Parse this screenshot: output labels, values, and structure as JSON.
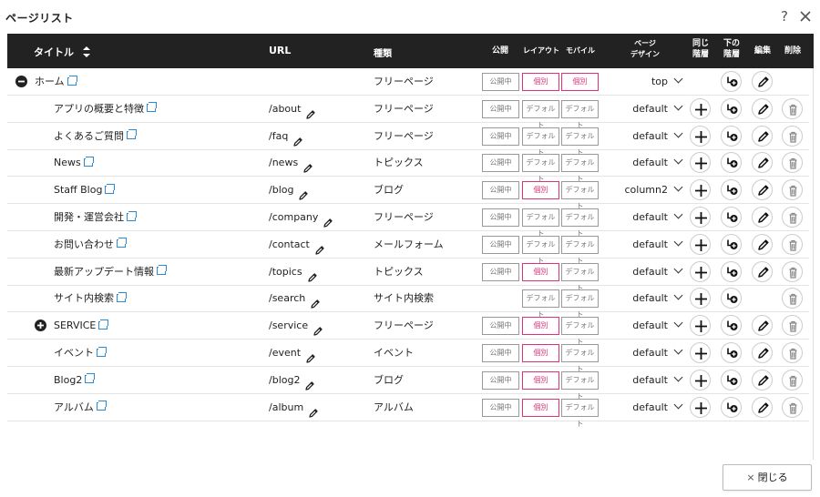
{
  "dialog": {
    "title": "ページリスト",
    "help": "?",
    "close_button": "閉じる",
    "close_glyph": "×"
  },
  "header": {
    "title": "タイトル",
    "url": "URL",
    "type": "種類",
    "publish": "公開",
    "layout": "レイアウト",
    "mobile": "モバイル",
    "page_design_line1": "ページ",
    "page_design_line2": "デザイン",
    "same_level_line1": "同じ",
    "same_level_line2": "階層",
    "lower_level_line1": "下の",
    "lower_level_line2": "階層",
    "edit": "編集",
    "delete": "削除"
  },
  "colors": {
    "header_bg": "#222222",
    "accent_pink": "#e0307a",
    "link_blue": "#2a8ad8"
  },
  "rows": [
    {
      "title": "ホーム",
      "indent": 0,
      "toggle": "minus",
      "url": "",
      "type": "フリーページ",
      "publish": "公開中",
      "layout": "個別",
      "layout_style": "pink",
      "mobile": "個別",
      "mobile_style": "pink",
      "design": "top",
      "add_same": false,
      "add_child": true,
      "edit": true,
      "delete": false
    },
    {
      "title": "アプリの概要と特徴",
      "indent": 1,
      "toggle": "",
      "url": "/about",
      "type": "フリーページ",
      "publish": "公開中",
      "layout": "デフォルト",
      "layout_style": "gray",
      "mobile": "デフォルト",
      "mobile_style": "gray",
      "design": "default",
      "add_same": true,
      "add_child": true,
      "edit": true,
      "delete": true
    },
    {
      "title": "よくあるご質問",
      "indent": 1,
      "toggle": "",
      "url": "/faq",
      "type": "フリーページ",
      "publish": "公開中",
      "layout": "デフォルト",
      "layout_style": "gray",
      "mobile": "デフォルト",
      "mobile_style": "gray",
      "design": "default",
      "add_same": true,
      "add_child": true,
      "edit": true,
      "delete": true
    },
    {
      "title": "News",
      "indent": 1,
      "toggle": "",
      "url": "/news",
      "type": "トピックス",
      "publish": "公開中",
      "layout": "デフォルト",
      "layout_style": "gray",
      "mobile": "デフォルト",
      "mobile_style": "gray",
      "design": "default",
      "add_same": true,
      "add_child": true,
      "edit": true,
      "delete": true
    },
    {
      "title": "Staff Blog",
      "indent": 1,
      "toggle": "",
      "url": "/blog",
      "type": "ブログ",
      "publish": "公開中",
      "layout": "個別",
      "layout_style": "pink",
      "mobile": "デフォルト",
      "mobile_style": "gray",
      "design": "column2",
      "add_same": true,
      "add_child": true,
      "edit": true,
      "delete": true
    },
    {
      "title": "開発・運営会社",
      "indent": 1,
      "toggle": "",
      "url": "/company",
      "type": "フリーページ",
      "publish": "公開中",
      "layout": "デフォルト",
      "layout_style": "gray",
      "mobile": "デフォルト",
      "mobile_style": "gray",
      "design": "default",
      "add_same": true,
      "add_child": true,
      "edit": true,
      "delete": true
    },
    {
      "title": "お問い合わせ",
      "indent": 1,
      "toggle": "",
      "url": "/contact",
      "type": "メールフォーム",
      "publish": "公開中",
      "layout": "デフォルト",
      "layout_style": "gray",
      "mobile": "デフォルト",
      "mobile_style": "gray",
      "design": "default",
      "add_same": true,
      "add_child": true,
      "edit": true,
      "delete": true
    },
    {
      "title": "最新アップデート情報",
      "indent": 1,
      "toggle": "",
      "url": "/topics",
      "type": "トピックス",
      "publish": "公開中",
      "layout": "個別",
      "layout_style": "pink",
      "mobile": "デフォルト",
      "mobile_style": "gray",
      "design": "default",
      "add_same": true,
      "add_child": true,
      "edit": true,
      "delete": true
    },
    {
      "title": "サイト内検索",
      "indent": 1,
      "toggle": "",
      "url": "/search",
      "type": "サイト内検索",
      "publish": "",
      "layout": "デフォルト",
      "layout_style": "gray",
      "mobile": "デフォルト",
      "mobile_style": "gray",
      "design": "default",
      "add_same": true,
      "add_child": true,
      "edit": false,
      "delete": true
    },
    {
      "title": "SERVICE",
      "indent": 1,
      "toggle": "plus",
      "url": "/service",
      "type": "フリーページ",
      "publish": "公開中",
      "layout": "個別",
      "layout_style": "pink",
      "mobile": "デフォルト",
      "mobile_style": "gray",
      "design": "default",
      "add_same": true,
      "add_child": true,
      "edit": true,
      "delete": true
    },
    {
      "title": "イベント",
      "indent": 1,
      "toggle": "",
      "url": "/event",
      "type": "イベント",
      "publish": "公開中",
      "layout": "個別",
      "layout_style": "pink",
      "mobile": "デフォルト",
      "mobile_style": "gray",
      "design": "default",
      "add_same": true,
      "add_child": true,
      "edit": true,
      "delete": true
    },
    {
      "title": "Blog2",
      "indent": 1,
      "toggle": "",
      "url": "/blog2",
      "type": "ブログ",
      "publish": "公開中",
      "layout": "個別",
      "layout_style": "pink",
      "mobile": "デフォルト",
      "mobile_style": "gray",
      "design": "default",
      "add_same": true,
      "add_child": true,
      "edit": true,
      "delete": true
    },
    {
      "title": "アルバム",
      "indent": 1,
      "toggle": "",
      "url": "/album",
      "type": "アルバム",
      "publish": "公開中",
      "layout": "個別",
      "layout_style": "pink",
      "mobile": "デフォルト",
      "mobile_style": "gray",
      "design": "default",
      "add_same": true,
      "add_child": true,
      "edit": true,
      "delete": true
    }
  ]
}
